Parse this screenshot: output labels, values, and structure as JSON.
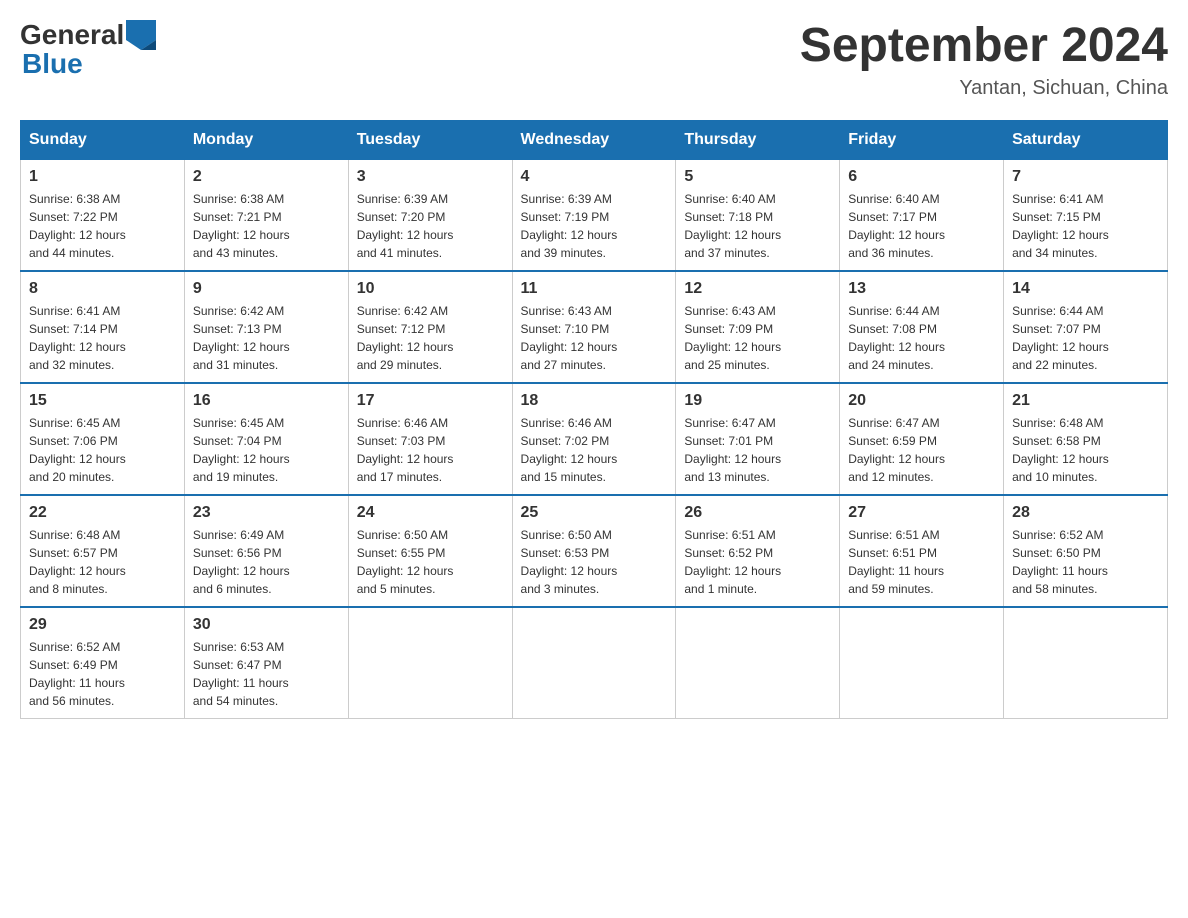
{
  "header": {
    "logo_general": "General",
    "logo_blue": "Blue",
    "title": "September 2024",
    "location": "Yantan, Sichuan, China"
  },
  "weekdays": [
    "Sunday",
    "Monday",
    "Tuesday",
    "Wednesday",
    "Thursday",
    "Friday",
    "Saturday"
  ],
  "weeks": [
    [
      {
        "day": "1",
        "sunrise": "6:38 AM",
        "sunset": "7:22 PM",
        "daylight": "12 hours and 44 minutes."
      },
      {
        "day": "2",
        "sunrise": "6:38 AM",
        "sunset": "7:21 PM",
        "daylight": "12 hours and 43 minutes."
      },
      {
        "day": "3",
        "sunrise": "6:39 AM",
        "sunset": "7:20 PM",
        "daylight": "12 hours and 41 minutes."
      },
      {
        "day": "4",
        "sunrise": "6:39 AM",
        "sunset": "7:19 PM",
        "daylight": "12 hours and 39 minutes."
      },
      {
        "day": "5",
        "sunrise": "6:40 AM",
        "sunset": "7:18 PM",
        "daylight": "12 hours and 37 minutes."
      },
      {
        "day": "6",
        "sunrise": "6:40 AM",
        "sunset": "7:17 PM",
        "daylight": "12 hours and 36 minutes."
      },
      {
        "day": "7",
        "sunrise": "6:41 AM",
        "sunset": "7:15 PM",
        "daylight": "12 hours and 34 minutes."
      }
    ],
    [
      {
        "day": "8",
        "sunrise": "6:41 AM",
        "sunset": "7:14 PM",
        "daylight": "12 hours and 32 minutes."
      },
      {
        "day": "9",
        "sunrise": "6:42 AM",
        "sunset": "7:13 PM",
        "daylight": "12 hours and 31 minutes."
      },
      {
        "day": "10",
        "sunrise": "6:42 AM",
        "sunset": "7:12 PM",
        "daylight": "12 hours and 29 minutes."
      },
      {
        "day": "11",
        "sunrise": "6:43 AM",
        "sunset": "7:10 PM",
        "daylight": "12 hours and 27 minutes."
      },
      {
        "day": "12",
        "sunrise": "6:43 AM",
        "sunset": "7:09 PM",
        "daylight": "12 hours and 25 minutes."
      },
      {
        "day": "13",
        "sunrise": "6:44 AM",
        "sunset": "7:08 PM",
        "daylight": "12 hours and 24 minutes."
      },
      {
        "day": "14",
        "sunrise": "6:44 AM",
        "sunset": "7:07 PM",
        "daylight": "12 hours and 22 minutes."
      }
    ],
    [
      {
        "day": "15",
        "sunrise": "6:45 AM",
        "sunset": "7:06 PM",
        "daylight": "12 hours and 20 minutes."
      },
      {
        "day": "16",
        "sunrise": "6:45 AM",
        "sunset": "7:04 PM",
        "daylight": "12 hours and 19 minutes."
      },
      {
        "day": "17",
        "sunrise": "6:46 AM",
        "sunset": "7:03 PM",
        "daylight": "12 hours and 17 minutes."
      },
      {
        "day": "18",
        "sunrise": "6:46 AM",
        "sunset": "7:02 PM",
        "daylight": "12 hours and 15 minutes."
      },
      {
        "day": "19",
        "sunrise": "6:47 AM",
        "sunset": "7:01 PM",
        "daylight": "12 hours and 13 minutes."
      },
      {
        "day": "20",
        "sunrise": "6:47 AM",
        "sunset": "6:59 PM",
        "daylight": "12 hours and 12 minutes."
      },
      {
        "day": "21",
        "sunrise": "6:48 AM",
        "sunset": "6:58 PM",
        "daylight": "12 hours and 10 minutes."
      }
    ],
    [
      {
        "day": "22",
        "sunrise": "6:48 AM",
        "sunset": "6:57 PM",
        "daylight": "12 hours and 8 minutes."
      },
      {
        "day": "23",
        "sunrise": "6:49 AM",
        "sunset": "6:56 PM",
        "daylight": "12 hours and 6 minutes."
      },
      {
        "day": "24",
        "sunrise": "6:50 AM",
        "sunset": "6:55 PM",
        "daylight": "12 hours and 5 minutes."
      },
      {
        "day": "25",
        "sunrise": "6:50 AM",
        "sunset": "6:53 PM",
        "daylight": "12 hours and 3 minutes."
      },
      {
        "day": "26",
        "sunrise": "6:51 AM",
        "sunset": "6:52 PM",
        "daylight": "12 hours and 1 minute."
      },
      {
        "day": "27",
        "sunrise": "6:51 AM",
        "sunset": "6:51 PM",
        "daylight": "11 hours and 59 minutes."
      },
      {
        "day": "28",
        "sunrise": "6:52 AM",
        "sunset": "6:50 PM",
        "daylight": "11 hours and 58 minutes."
      }
    ],
    [
      {
        "day": "29",
        "sunrise": "6:52 AM",
        "sunset": "6:49 PM",
        "daylight": "11 hours and 56 minutes."
      },
      {
        "day": "30",
        "sunrise": "6:53 AM",
        "sunset": "6:47 PM",
        "daylight": "11 hours and 54 minutes."
      },
      null,
      null,
      null,
      null,
      null
    ]
  ],
  "labels": {
    "sunrise": "Sunrise:",
    "sunset": "Sunset:",
    "daylight": "Daylight:"
  }
}
